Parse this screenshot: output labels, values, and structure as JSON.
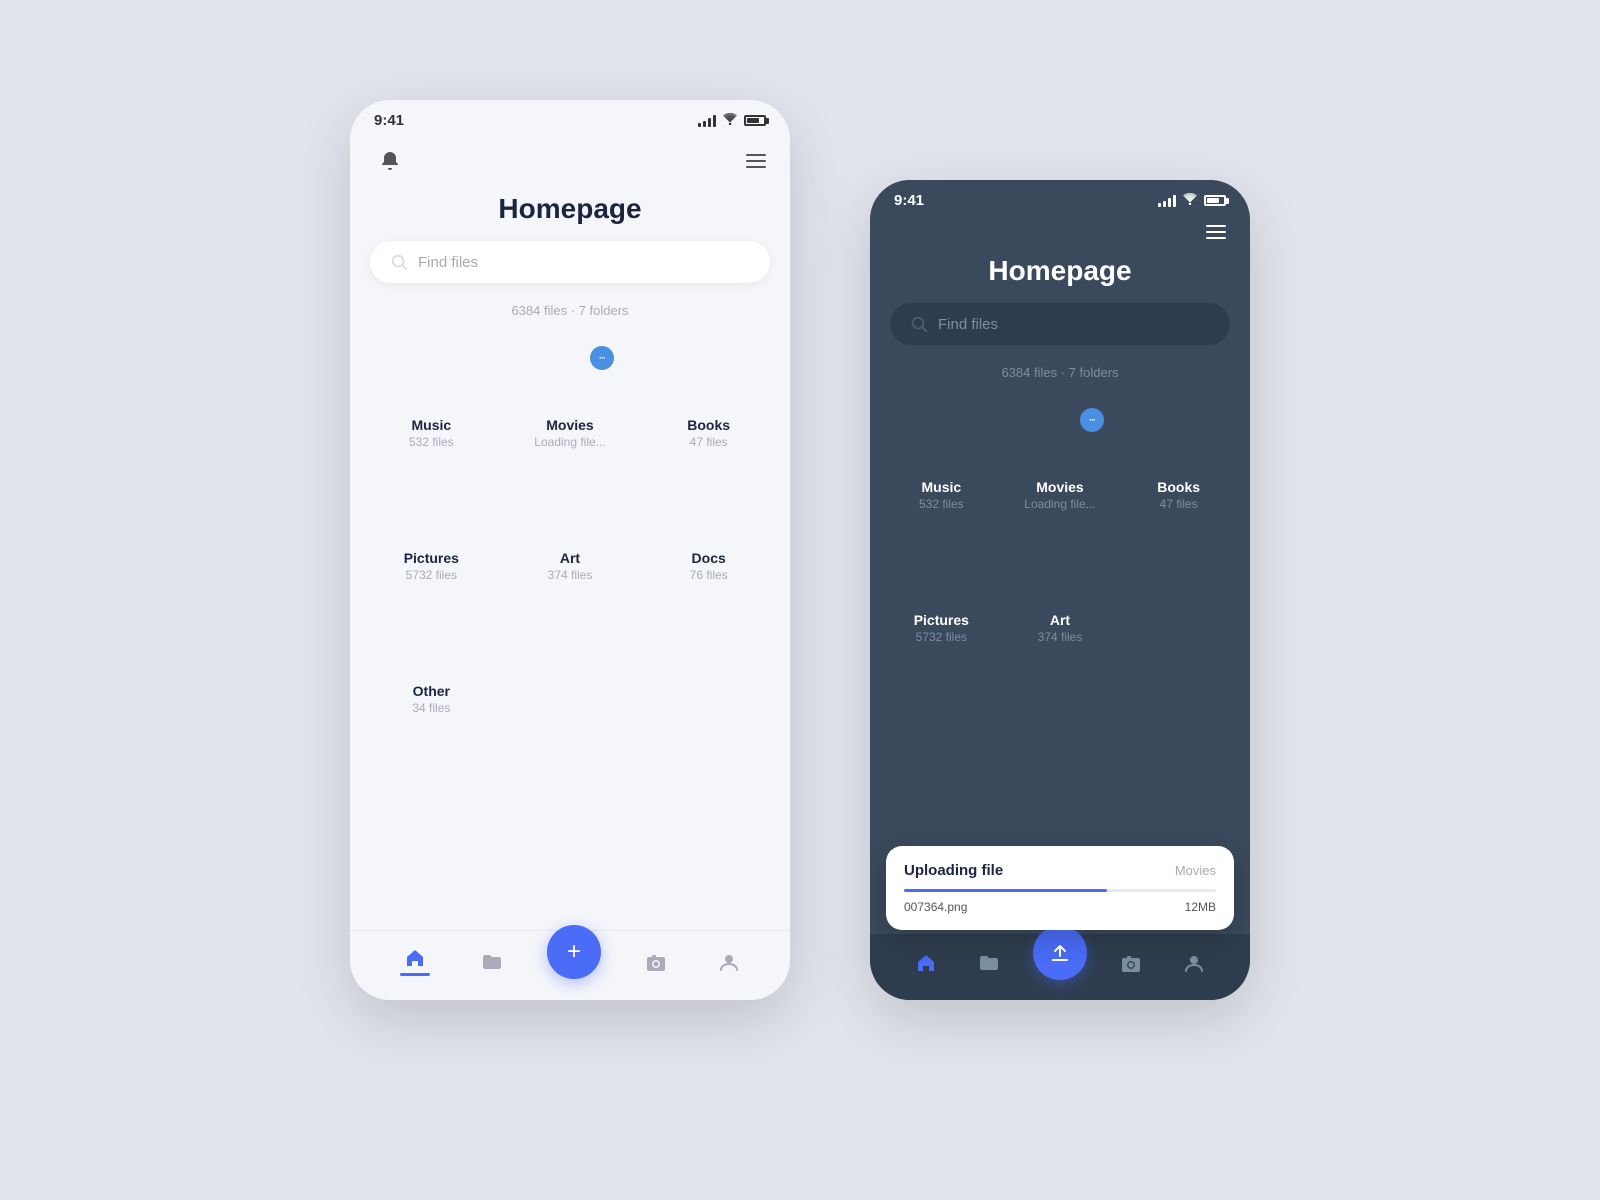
{
  "background": "#e2e4ed",
  "phones": {
    "light": {
      "statusBar": {
        "time": "9:41",
        "theme": "light"
      },
      "title": "Homepage",
      "search": {
        "placeholder": "Find files"
      },
      "fileCount": "6384 files · 7 folders",
      "folders": [
        {
          "id": "music",
          "name": "Music",
          "count": "532 files",
          "color": "purple",
          "loading": false
        },
        {
          "id": "movies",
          "name": "Movies",
          "count": "Loading file...",
          "color": "green",
          "loading": true
        },
        {
          "id": "books",
          "name": "Books",
          "count": "47 files",
          "color": "teal",
          "loading": false
        },
        {
          "id": "pictures",
          "name": "Pictures",
          "count": "5732 files",
          "color": "orange",
          "loading": false
        },
        {
          "id": "art",
          "name": "Art",
          "count": "374 files",
          "color": "coral",
          "loading": false
        },
        {
          "id": "docs",
          "name": "Docs",
          "count": "76 files",
          "color": "navy",
          "loading": false
        },
        {
          "id": "other",
          "name": "Other",
          "count": "34 files",
          "color": "gray",
          "loading": false
        }
      ],
      "nav": {
        "items": [
          "home",
          "folder",
          "add",
          "camera",
          "user"
        ]
      }
    },
    "dark": {
      "statusBar": {
        "time": "9:41",
        "theme": "dark"
      },
      "title": "Homepage",
      "search": {
        "placeholder": "Find files"
      },
      "fileCount": "6384 files · 7 folders",
      "folders": [
        {
          "id": "music",
          "name": "Music",
          "count": "532 files",
          "color": "purple",
          "loading": false
        },
        {
          "id": "movies",
          "name": "Movies",
          "count": "Loading file...",
          "color": "green",
          "loading": true
        },
        {
          "id": "books",
          "name": "Books",
          "count": "47 files",
          "color": "teal",
          "loading": false
        },
        {
          "id": "pictures",
          "name": "Pictures",
          "count": "5732 files",
          "color": "orange",
          "loading": false
        },
        {
          "id": "art",
          "name": "Art",
          "count": "374 files",
          "color": "coral",
          "loading": false
        }
      ],
      "uploadCard": {
        "title": "Uploading file",
        "location": "Movies",
        "filename": "007364.png",
        "filesize": "12MB",
        "progress": 65
      },
      "nav": {
        "items": [
          "home",
          "folder",
          "add",
          "camera",
          "user"
        ]
      }
    }
  },
  "icons": {
    "loading_dots": "···",
    "plus": "+",
    "bell": "🔔",
    "search": "⌕"
  }
}
